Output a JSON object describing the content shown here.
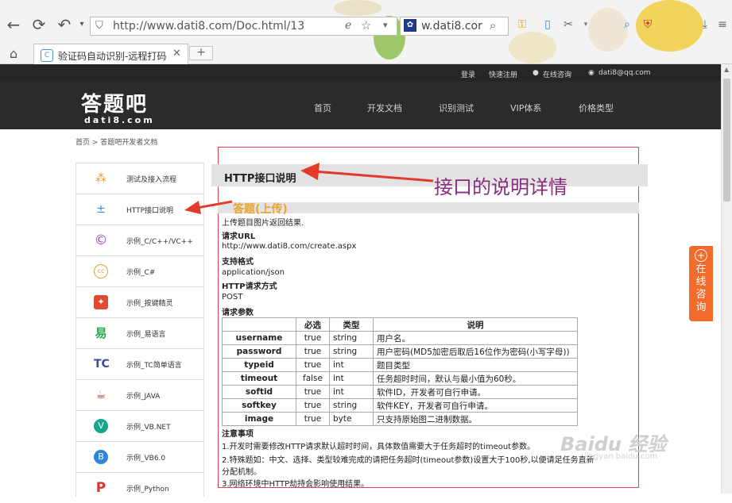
{
  "browser": {
    "url": "http://www.dati8.com/Doc.html/13",
    "search_text": "w.dati8.cor",
    "tab_title": "验证码自动识别-远程打码",
    "new_tab": "+",
    "close": "✕"
  },
  "site": {
    "toplinks": [
      "登录",
      "快速注册",
      "在线咨询",
      "dati8@qq.com"
    ],
    "logo_main": "答题吧",
    "logo_sub": "dati8.com",
    "nav": [
      "首页",
      "开发文档",
      "识别测试",
      "VIP体系",
      "价格类型"
    ],
    "breadcrumb": "首页 > 答题吧开发者文档"
  },
  "sidebar": {
    "items": [
      {
        "label": "测试及接入流程",
        "icon": "flow-icon"
      },
      {
        "label": "HTTP接口说明",
        "icon": "plus-minus-icon"
      },
      {
        "label": "示例_C/C++/VC++",
        "icon": "copyright-icon"
      },
      {
        "label": "示例_C#",
        "icon": "cc-icon"
      },
      {
        "label": "示例_按键精灵",
        "icon": "key-sprite-icon"
      },
      {
        "label": "示例_易语言",
        "icon": "yi-icon"
      },
      {
        "label": "示例_TC简单语言",
        "icon": "tc-icon"
      },
      {
        "label": "示例_JAVA",
        "icon": "java-icon"
      },
      {
        "label": "示例_VB.NET",
        "icon": "vbnet-icon"
      },
      {
        "label": "示例_VB6.0",
        "icon": "vb6-icon"
      },
      {
        "label": "示例_Python",
        "icon": "python-icon"
      }
    ]
  },
  "content": {
    "title": "HTTP接口说明",
    "section_title": "答题(上传)",
    "desc": "上传题目图片返回结果.",
    "url_label": "请求URL",
    "url_value": "http://www.dati8.com/create.aspx",
    "format_label": "支持格式",
    "format_value": "application/json",
    "method_label": "HTTP请求方式",
    "method_value": "POST",
    "params_label": "请求参数",
    "table": {
      "headers": [
        "",
        "必选",
        "类型",
        "说明"
      ],
      "rows": [
        [
          "username",
          "true",
          "string",
          "用户名。"
        ],
        [
          "password",
          "true",
          "string",
          "用户密码(MD5加密后取后16位作为密码(小写字母))"
        ],
        [
          "typeid",
          "true",
          "int",
          "题目类型"
        ],
        [
          "timeout",
          "false",
          "int",
          "任务超时时间，默认与最小值为60秒。"
        ],
        [
          "softid",
          "true",
          "int",
          "软件ID，开发者可自行申请。"
        ],
        [
          "softkey",
          "true",
          "string",
          "软件KEY，开发者可自行申请。"
        ],
        [
          "image",
          "true",
          "byte",
          "只支持原始图二进制数据。"
        ]
      ]
    },
    "notes_label": "注意事项",
    "notes": [
      "1.开发时需要修改HTTP请求默认超时时间，具体数值需要大于任务超时的timeout参数。",
      "2.特殊题如：中文、选择、类型较难完成的请把任务超时(timeout参数)设置大于100秒,以便请足任务直新",
      "分配机制。",
      "3.网络环境中HTTP劫持会影响使用结果。"
    ]
  },
  "annotation": "接口的说明详情",
  "consult": {
    "label": "在线咨询"
  },
  "watermark": {
    "main": "Baidu 经验",
    "sub": "jingyan.baidu.com"
  },
  "colors": {
    "annotation_arrow": "#e23b2c",
    "frame_border": "#d04848",
    "consult_bg": "#f26b2a",
    "section_title": "#e8a32c"
  }
}
